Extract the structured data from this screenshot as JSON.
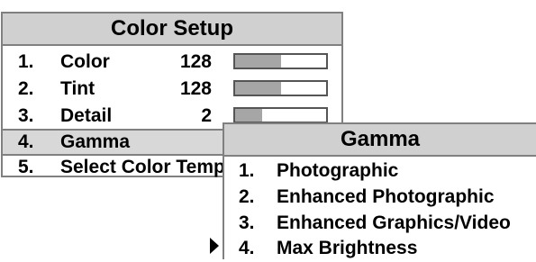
{
  "color_setup": {
    "title": "Color Setup",
    "items": [
      {
        "num": "1.",
        "label": "Color",
        "value": "128",
        "level": 0.5
      },
      {
        "num": "2.",
        "label": "Tint",
        "value": "128",
        "level": 0.5
      },
      {
        "num": "3.",
        "label": "Detail",
        "value": "2",
        "level": 0.3
      },
      {
        "num": "4.",
        "label": "Gamma"
      },
      {
        "num": "5.",
        "label": "Select Color Temp"
      }
    ]
  },
  "gamma": {
    "title": "Gamma",
    "items": [
      {
        "num": "1.",
        "label": "Photographic"
      },
      {
        "num": "2.",
        "label": "Enhanced Photographic"
      },
      {
        "num": "3.",
        "label": "Enhanced Graphics/Video"
      },
      {
        "num": "4.",
        "label": "Max Brightness"
      }
    ]
  },
  "colors": {
    "title_bg": "#d0d0d0",
    "border": "#808080",
    "slider_fill": "#a6a6a6"
  }
}
